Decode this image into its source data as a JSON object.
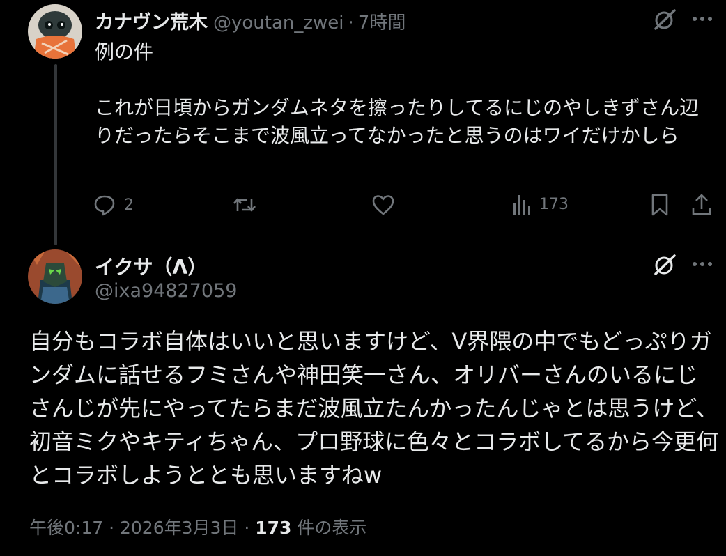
{
  "tweet1": {
    "display_name": "カナヴン荒木",
    "handle": "@youtan_zwei",
    "separator": "·",
    "time": "7時間",
    "text": "例の件\n\nこれが日頃からガンダムネタを擦ったりしてるにじのやしきずさん辺りだったらそこまで波風立ってなかったと思うのはワイだけかしら",
    "actions": {
      "reply_count": "2",
      "views_count": "173"
    }
  },
  "tweet2": {
    "display_name": "イクサ（Λ）",
    "handle": "@ixa94827059",
    "text": "自分もコラボ自体はいいと思いますけど、V界隈の中でもどっぷりガンダムに話せるフミさんや神田笑一さん、オリバーさんのいるにじさんじが先にやってたらまだ波風立たんかったんじゃとは思うけど、初音ミクやキティちゃん、プロ野球に色々とコラボしてるから今更何とコラボしようととも思いますねw",
    "timestamp": "午後0:17 · 2026年3月3日 · ",
    "views_number": "173",
    "views_label": " 件の表示"
  },
  "icons": [
    "grok-icon",
    "more-icon",
    "reply-icon",
    "retweet-icon",
    "like-icon",
    "views-icon",
    "bookmark-icon",
    "share-icon"
  ],
  "colors": {
    "background": "#000000",
    "text": "#e7e9ea",
    "muted": "#71767b",
    "divider": "#333639"
  }
}
